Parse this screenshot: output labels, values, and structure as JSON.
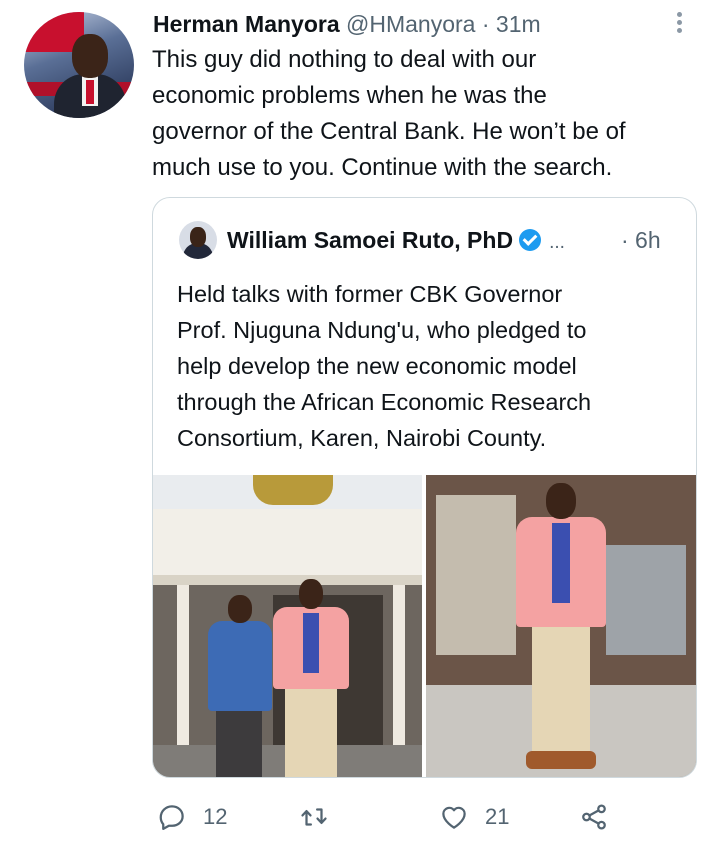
{
  "tweet": {
    "author_name": "Herman Manyora",
    "author_handle": "@HManyora",
    "separator": "·",
    "time": "31m",
    "text": "This guy did nothing to deal with our\neconomic problems when he was the\ngovernor of the Central Bank. He won’t be of\nmuch use to you. Continue with the search."
  },
  "quoted_tweet": {
    "author_name": "William Samoei Ruto, PhD",
    "ellipsis": "...",
    "time": "· 6h",
    "text": "Held talks with former CBK Governor\nProf. Njuguna Ndung'u, who pledged to\nhelp develop the new economic model\nthrough the African Economic Research\nConsortium, Karen, Nairobi County."
  },
  "actions": {
    "reply_count": "12",
    "retweet_count": "",
    "like_count": "21"
  },
  "icons": {
    "more": "more-vertical-icon",
    "verified": "verified-badge-icon",
    "reply": "reply-icon",
    "retweet": "retweet-icon",
    "like": "heart-icon",
    "share": "share-icon"
  },
  "colors": {
    "text": "#0f1419",
    "secondary": "#536471",
    "verified": "#1d9bf0",
    "border": "#cfd9de"
  }
}
